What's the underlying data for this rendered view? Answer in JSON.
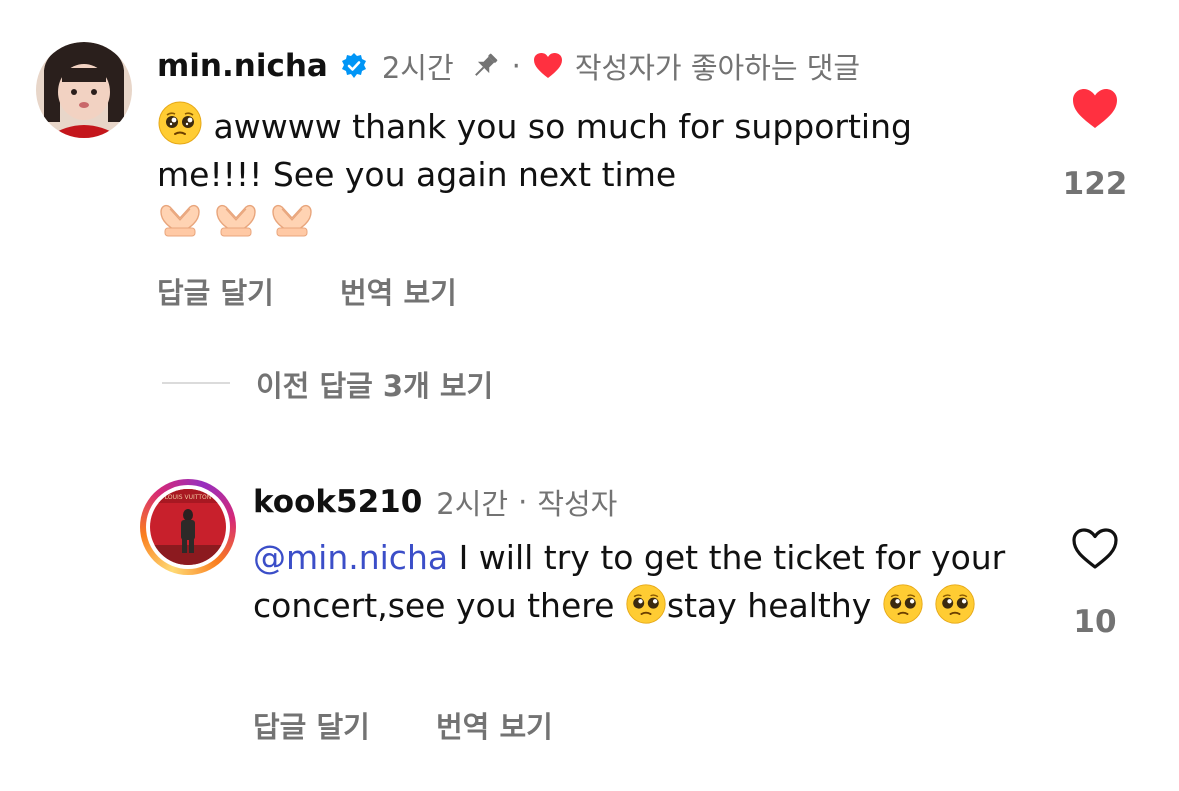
{
  "comment_1": {
    "username": "min.nicha",
    "verified": true,
    "time": "2시간",
    "separator": "·",
    "liked_by_author_label": "작성자가 좋아하는 댓글",
    "pinned": true,
    "text": "awwww thank you so much for supporting me!!!! See you again next time",
    "leading_emoji": "pleading-face",
    "trailing_emojis": [
      "heart-hands",
      "heart-hands",
      "heart-hands"
    ],
    "like_count": "122",
    "liked": true,
    "reply_label": "답글 달기",
    "translate_label": "번역 보기"
  },
  "view_previous_replies_label": "이전 답글 3개 보기",
  "comment_2": {
    "username": "kook5210",
    "time": "2시간",
    "separator": "·",
    "author_label": "작성자",
    "mention": "@min.nicha",
    "text_before_emoji": " I will try to get the ticket for your concert,see you there ",
    "text_after_emoji": "stay healthy ",
    "emojis": [
      "pleading-face",
      "pleading-face",
      "pleading-face"
    ],
    "like_count": "10",
    "liked": false,
    "reply_label": "답글 달기",
    "translate_label": "번역 보기",
    "has_story_ring": true
  },
  "colors": {
    "text": "#111111",
    "secondary": "#737373",
    "mention": "#3b4ec8",
    "like_red": "#ff3040",
    "verified_blue": "#0095f6"
  }
}
